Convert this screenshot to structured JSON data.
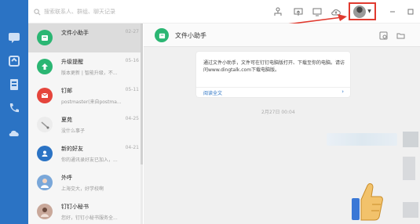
{
  "colors": {
    "rail": "#2b73c4",
    "accent_green": "#2bb673",
    "highlight": "#e03a2f"
  },
  "search": {
    "placeholder": "搜索联系人、群组、聊天记录"
  },
  "top_icons": [
    "org-icon",
    "screen-icon",
    "monitor-icon",
    "cloud-icon"
  ],
  "conversations": [
    {
      "name": "文件小助手",
      "time": "02-27",
      "preview": "",
      "avatar": "file-icon",
      "color": "#2bb673",
      "active": true
    },
    {
      "name": "升级提醒",
      "time": "05-16",
      "preview": "版本更新 | 智能升级，不...",
      "avatar": "upgrade-arrow-icon",
      "color": "#2bb673"
    },
    {
      "name": "钉邮",
      "time": "05-11",
      "preview": "postmaster(来自postma...",
      "avatar": "mail-icon",
      "color": "#e5453c"
    },
    {
      "name": "夏苑",
      "time": "04-25",
      "preview": "没什么事子",
      "avatar": "photo-avatar",
      "color": "#e8e8e8"
    },
    {
      "name": "新的好友",
      "time": "04-21",
      "preview": "你的通讯录好友已加入，...",
      "avatar": "new-friend-icon",
      "color": "#2b73c4"
    },
    {
      "name": "外呼",
      "time": "",
      "preview": "上海交大，好学校啊",
      "avatar": "photo-avatar-2",
      "color": "#7aa7d9"
    },
    {
      "name": "钉钉小秘书",
      "time": "",
      "preview": "您好，钉钉小秘书服务全...",
      "avatar": "photo-avatar-3",
      "color": "#c9a89a"
    }
  ],
  "chat": {
    "title": "文件小助手",
    "card_text": "通过文件小助手，文件可在钉钉电脑版打开、下载至你的电脑。请访问www.dingtalk.com下载电脑版。",
    "card_link": "阅读全文",
    "date": "2月27日 00:04"
  }
}
